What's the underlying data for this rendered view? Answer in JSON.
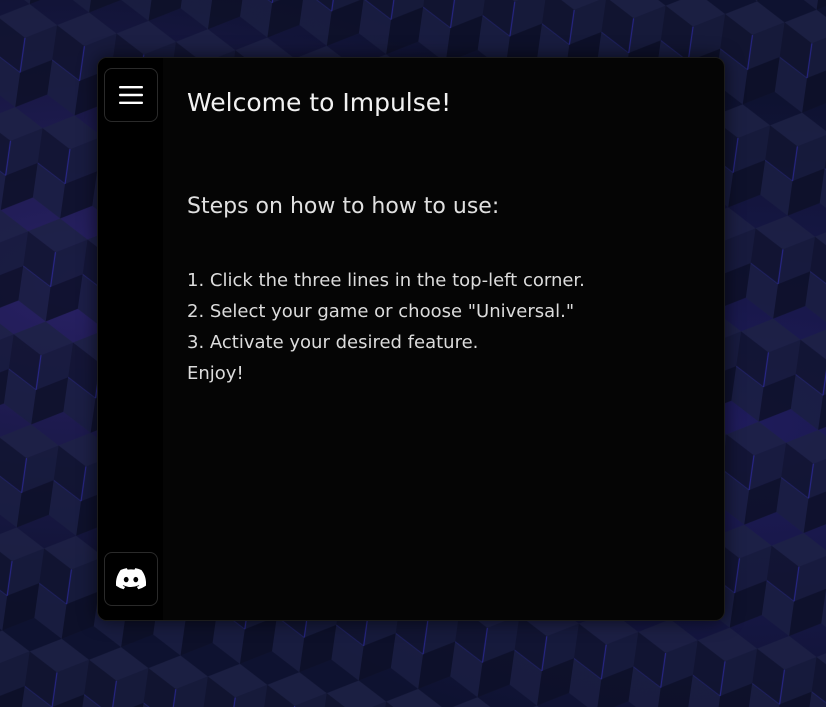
{
  "app": {
    "title": "Welcome to Impulse!",
    "subtitle": "Steps on how to how to use:",
    "steps": [
      "1. Click the three lines in the top-left corner.",
      "2. Select your game or choose \"Universal.\"",
      "3. Activate your desired feature.",
      "Enjoy!"
    ]
  },
  "sidebar": {
    "menu_icon": "hamburger-menu-icon",
    "discord_icon": "discord-icon"
  },
  "colors": {
    "window_bg": "#050505",
    "sidebar_bg": "#000000",
    "text": "#f2f2f2",
    "background_accent": "#3a2fd0"
  }
}
